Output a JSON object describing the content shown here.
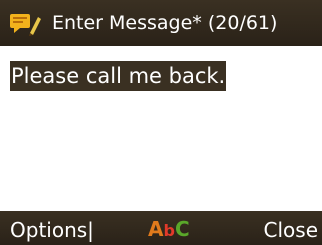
{
  "header": {
    "icon": "message-edit-icon",
    "title": "Enter Message* (20/61)"
  },
  "editor": {
    "text": "Please call me back."
  },
  "softkeys": {
    "left": "Options|",
    "right": "Close"
  },
  "input_mode": {
    "icon": "abc-input-mode-icon",
    "letters": [
      "A",
      "b",
      "C"
    ]
  },
  "colors": {
    "bar_background": "#2a2218",
    "selection_highlight": "#3a3022",
    "text_on_bar": "#ffffff",
    "input_mode_a": "#e07a1c",
    "input_mode_b": "#e23a2a",
    "input_mode_c": "#5aa72a",
    "icon_envelope": "#f2b21c"
  }
}
